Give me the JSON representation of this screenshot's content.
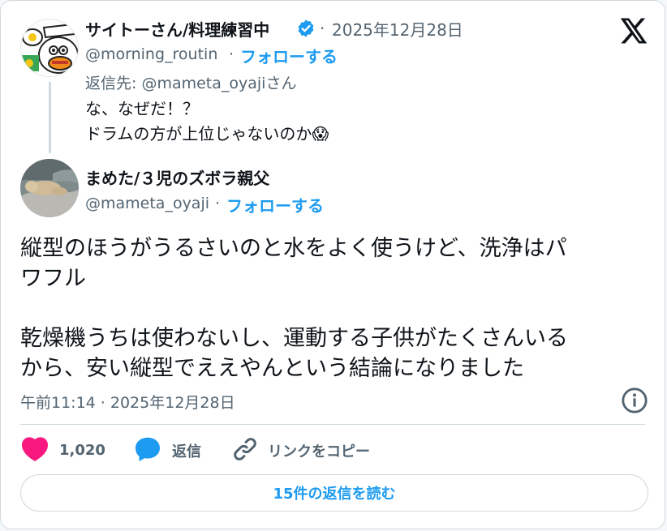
{
  "reply_tweet": {
    "author_name": "サイトーさん/料理練習中",
    "date": "2025年12月28日",
    "handle": "@morning_routin",
    "follow_label": "フォローする",
    "reply_to_prefix": "返信先: ",
    "reply_to_handle": "@mameta_oyaji",
    "reply_to_suffix": "さん",
    "text_line1": "な、なぜだ！？",
    "text_line2": "ドラムの方が上位じゃないのか",
    "emoji": "😱"
  },
  "main_tweet": {
    "author_name": "まめた/３児のズボラ親父",
    "handle": "@mameta_oyaji",
    "follow_label": "フォローする",
    "para1_line1": "縦型のほうがうるさいのと水をよく使うけど、洗浄はパ",
    "para1_line2": "ワフル",
    "para2_line1": "乾燥機うちは使わないし、運動する子供がたくさんいる",
    "para2_line2": "から、安い縦型でええやんという結論になりました",
    "timestamp": "午前11:14 · 2025年12月28日"
  },
  "actions": {
    "like_count": "1,020",
    "reply_label": "返信",
    "copy_link_label": "リンクをコピー",
    "read_replies_label": "15件の返信を読む"
  },
  "colors": {
    "accent": "#1d9bf0",
    "like": "#f91880",
    "muted": "#536471",
    "border": "#cfd9de"
  },
  "icons": [
    "verified-badge-icon",
    "x-logo-icon",
    "info-icon",
    "heart-icon",
    "reply-bubble-icon",
    "link-icon"
  ]
}
